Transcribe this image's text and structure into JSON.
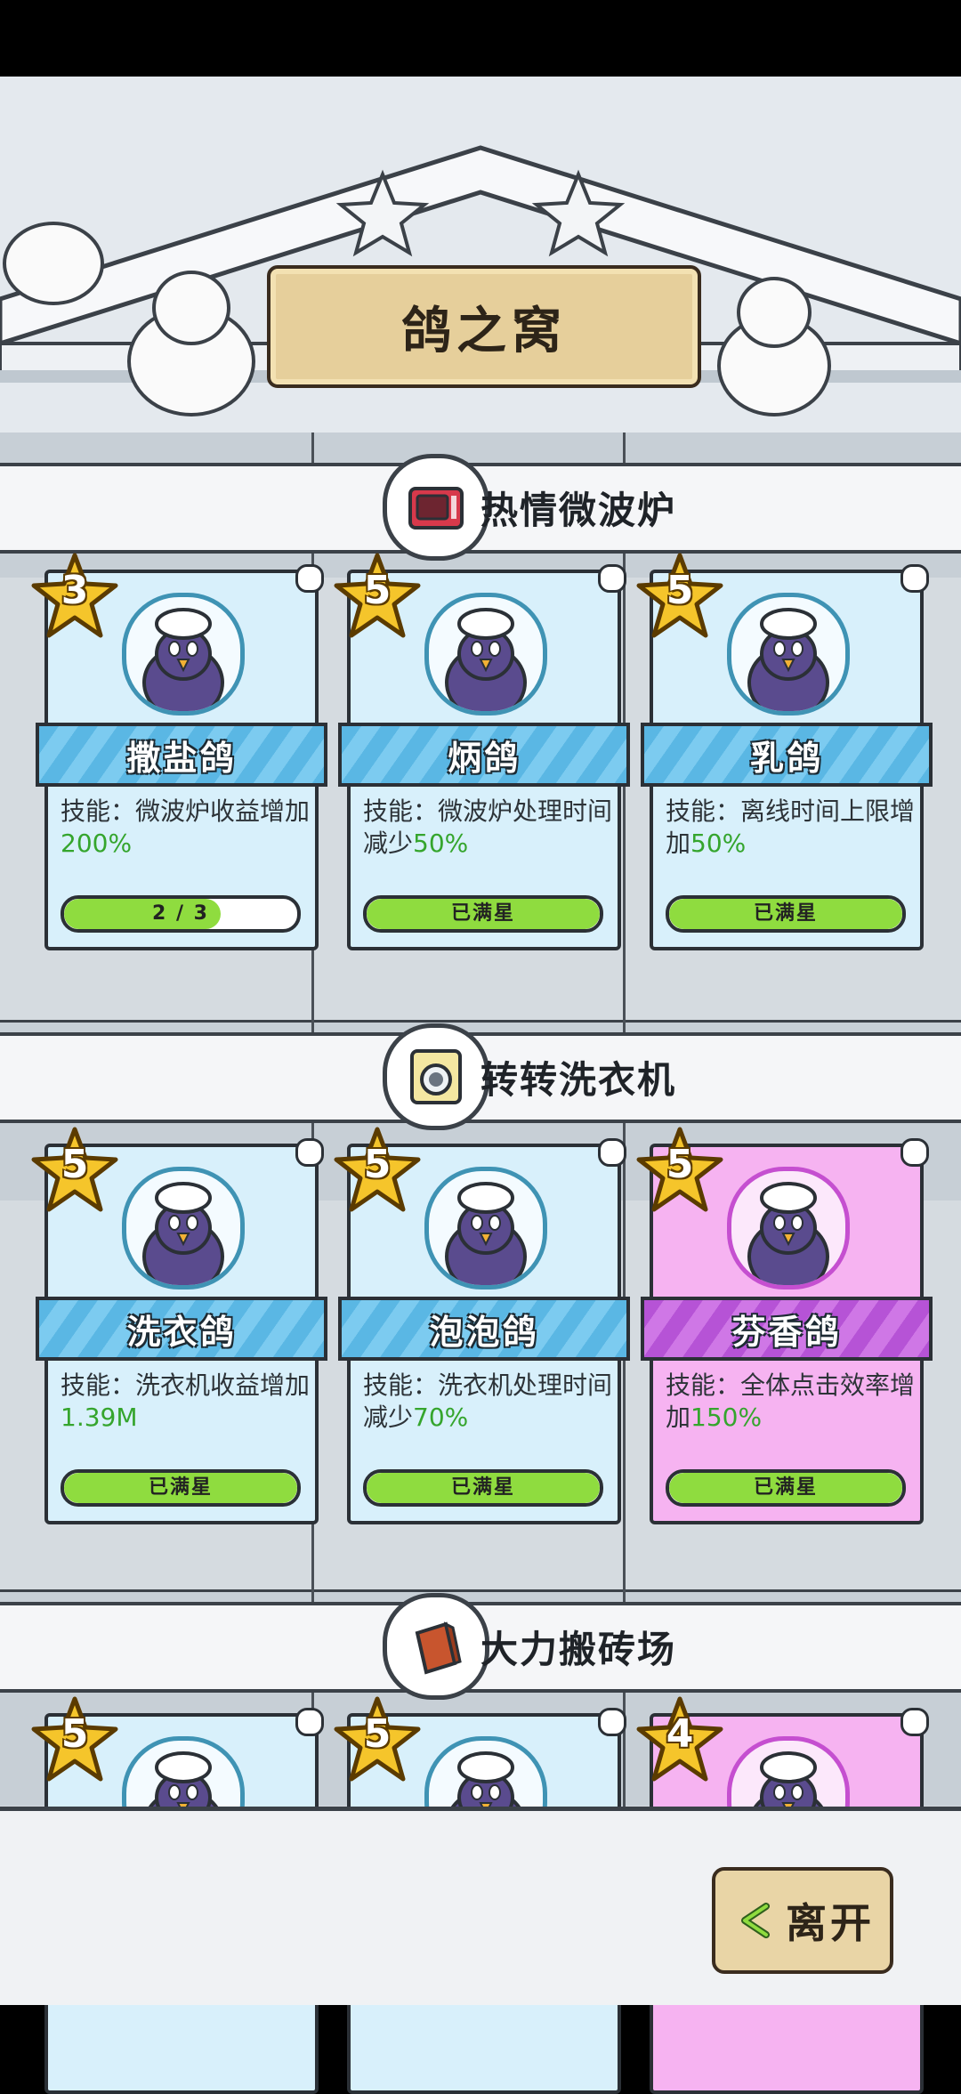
{
  "title": "鸽之窝",
  "sections": [
    {
      "name": "热情微波炉",
      "icon": "microwave-icon",
      "cards": [
        {
          "stars": "3",
          "name": "撒盐鸽",
          "skill_text": "技能：微波炉收益增加",
          "skill_value": "200%",
          "progress_label": "2 / 3",
          "progress": 0.67,
          "theme": "blue"
        },
        {
          "stars": "5",
          "name": "炳鸽",
          "skill_text": "技能：微波炉处理时间减少",
          "skill_value": "50%",
          "progress_label": "已满星",
          "progress": 1.0,
          "theme": "blue"
        },
        {
          "stars": "5",
          "name": "乳鸽",
          "skill_text": "技能：离线时间上限增加",
          "skill_value": "50%",
          "progress_label": "已满星",
          "progress": 1.0,
          "theme": "blue"
        }
      ]
    },
    {
      "name": "转转洗衣机",
      "icon": "washing-machine-icon",
      "cards": [
        {
          "stars": "5",
          "name": "洗衣鸽",
          "skill_text": "技能：洗衣机收益增加",
          "skill_value": "1.39M",
          "progress_label": "已满星",
          "progress": 1.0,
          "theme": "blue"
        },
        {
          "stars": "5",
          "name": "泡泡鸽",
          "skill_text": "技能：洗衣机处理时间减少",
          "skill_value": "70%",
          "progress_label": "已满星",
          "progress": 1.0,
          "theme": "blue"
        },
        {
          "stars": "5",
          "name": "芬香鸽",
          "skill_text": "技能：全体点击效率增加",
          "skill_value": "150%",
          "progress_label": "已满星",
          "progress": 1.0,
          "theme": "pink"
        }
      ]
    },
    {
      "name": "大力搬砖场",
      "icon": "brick-icon",
      "cards": [
        {
          "stars": "5",
          "theme": "blue"
        },
        {
          "stars": "5",
          "theme": "blue"
        },
        {
          "stars": "4",
          "theme": "pink"
        }
      ]
    }
  ],
  "leave_button": "离开",
  "colors": {
    "accent_green": "#35a52d",
    "card_blue": "#d8f0fb",
    "card_pink": "#f6b3f1",
    "wood": "#e6cf9b"
  }
}
